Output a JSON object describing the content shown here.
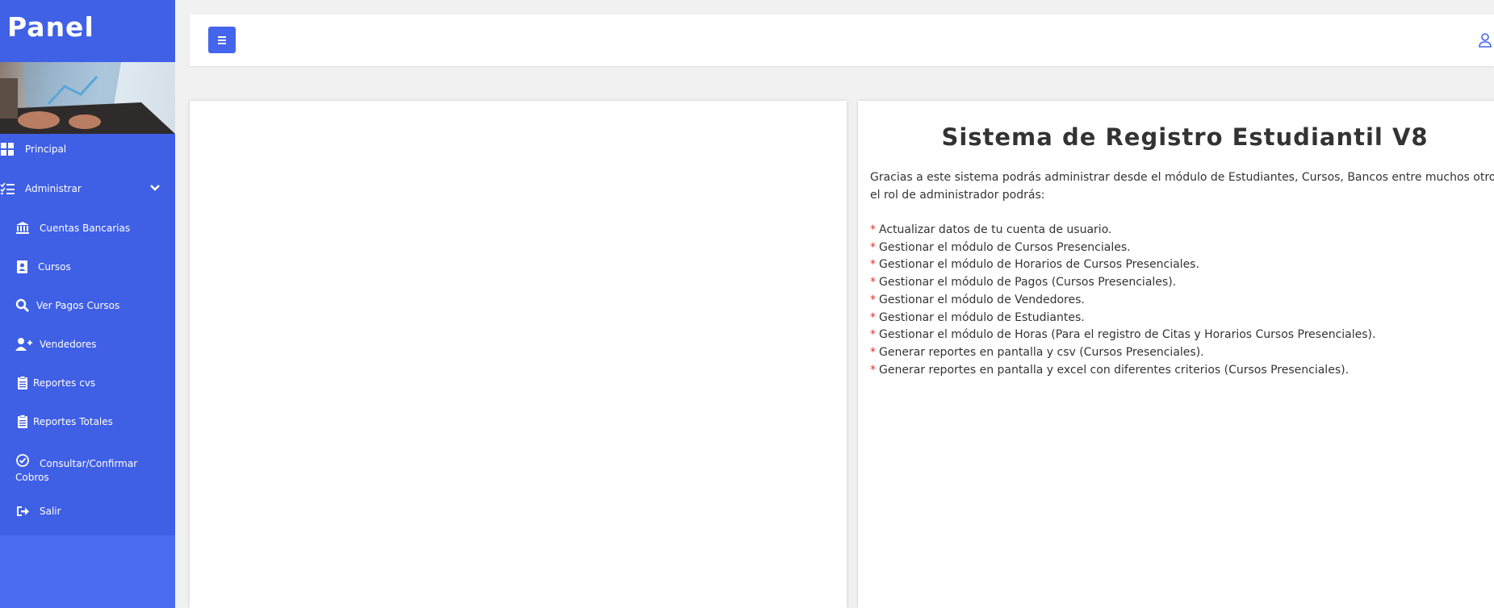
{
  "brand": {
    "title": "Panel"
  },
  "sidebar": {
    "items": [
      {
        "label": "Principal",
        "icon": "dashboard-icon"
      },
      {
        "label": "Administrar",
        "icon": "tasks-icon"
      },
      {
        "label": "Cuentas Bancarias",
        "icon": "bank-icon"
      },
      {
        "label": "Cursos",
        "icon": "id-card-icon"
      },
      {
        "label": "Ver Pagos Cursos",
        "icon": "search-icon"
      },
      {
        "label": "Vendedores",
        "icon": "user-plus-icon"
      },
      {
        "label": "Reportes cvs",
        "icon": "clipboard-icon"
      },
      {
        "label": "Reportes Totales",
        "icon": "clipboard-icon"
      },
      {
        "label": "Consultar/Confirmar Cobros",
        "icon": "check-circle-icon"
      },
      {
        "label": "Salir",
        "icon": "sign-out-icon"
      }
    ]
  },
  "content": {
    "title": "Sistema de Registro Estudiantil V8",
    "intro_line1": "Gracias a este sistema podrás administrar desde el módulo de Estudiantes, Cursos, Bancos entre muchos otros. Co",
    "intro_line2": "el rol de administrador podrás:",
    "bullet": "*",
    "features": [
      "Actualizar datos de tu cuenta de usuario.",
      "Gestionar el módulo de Cursos Presenciales.",
      "Gestionar el módulo de Horarios de Cursos Presenciales.",
      "Gestionar el módulo de Pagos (Cursos Presenciales).",
      "Gestionar el módulo de Vendedores.",
      "Gestionar el módulo de Estudiantes.",
      "Gestionar el módulo de Horas (Para el registro de Citas y Horarios Cursos Presenciales).",
      "Generar reportes en pantalla y csv (Cursos Presenciales).",
      "Generar reportes en pantalla y excel con diferentes criterios (Cursos Presenciales)."
    ]
  },
  "colors": {
    "sidebar": "#4a6cf0",
    "accent": "#4465ec",
    "bullet": "#e03030"
  }
}
